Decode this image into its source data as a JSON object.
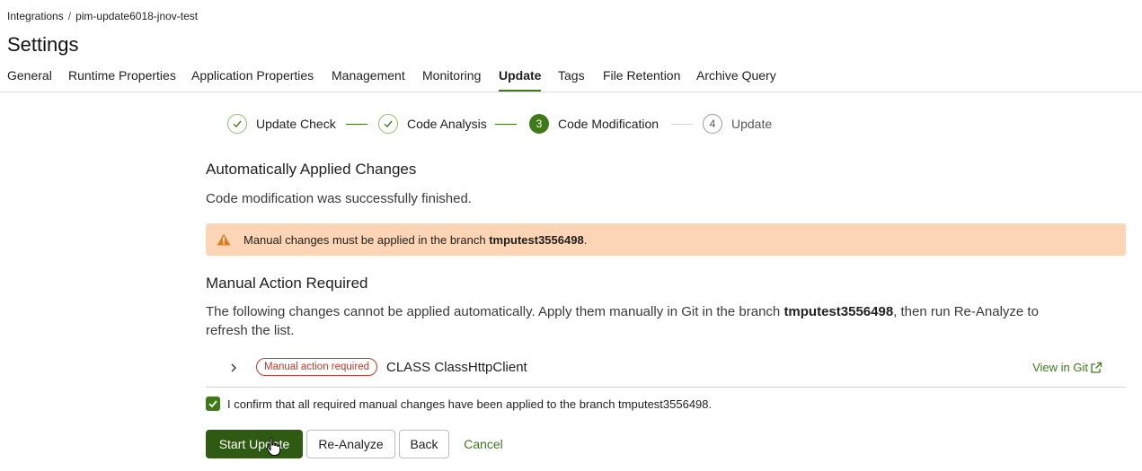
{
  "breadcrumb": {
    "parent": "Integrations",
    "separator": "/",
    "current": "pim-update6018-jnov-test"
  },
  "page_title": "Settings",
  "tabs": [
    {
      "label": "General"
    },
    {
      "label": "Runtime Properties"
    },
    {
      "label": "Application Properties"
    },
    {
      "label": "Management"
    },
    {
      "label": "Monitoring"
    },
    {
      "label": "Update",
      "active": true
    },
    {
      "label": "Tags"
    },
    {
      "label": "File Retention"
    },
    {
      "label": "Archive Query"
    }
  ],
  "stepper": {
    "steps": [
      {
        "number": "",
        "label": "Update Check",
        "state": "done"
      },
      {
        "number": "",
        "label": "Code Analysis",
        "state": "done"
      },
      {
        "number": "3",
        "label": "Code Modification",
        "state": "current"
      },
      {
        "number": "4",
        "label": "Update",
        "state": "todo"
      }
    ]
  },
  "auto_changes": {
    "heading": "Automatically Applied Changes",
    "message": "Code modification was successfully finished."
  },
  "alert": {
    "prefix": "Manual changes must be applied in the branch ",
    "branch": "tmputest3556498",
    "suffix": "."
  },
  "manual": {
    "heading": "Manual Action Required",
    "desc_prefix": "The following changes cannot be applied automatically. Apply them manually in Git in the branch ",
    "branch": "tmputest3556498",
    "desc_mid": ", then run Re-Analyze to",
    "desc_line2": "refresh the list.",
    "item": {
      "badge": "Manual action required",
      "name": "CLASS ClassHttpClient",
      "link": "View in Git"
    }
  },
  "confirm": {
    "checked": true,
    "label": "I confirm that all required manual changes have been applied to the branch tmputest3556498."
  },
  "buttons": {
    "start_update": "Start Update",
    "reanalyze": "Re-Analyze",
    "back": "Back",
    "cancel": "Cancel"
  },
  "colors": {
    "accent": "#3f7a18",
    "primary_button": "#2f5a12",
    "warning_bg": "#fbd5b5",
    "warning_icon": "#e07b1f",
    "danger": "#c0392b"
  }
}
